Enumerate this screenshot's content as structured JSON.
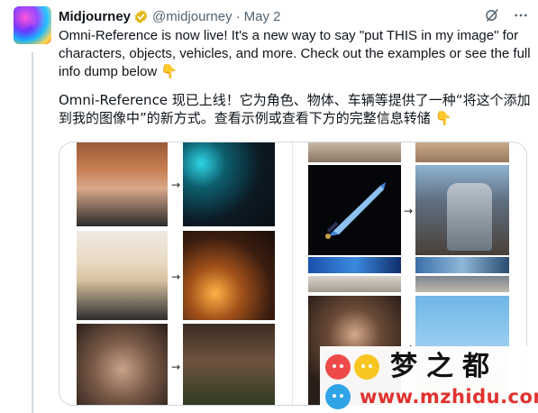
{
  "tweet": {
    "author_name": "Midjourney",
    "handle": "@midjourney",
    "separator": "·",
    "date": "May 2",
    "text_en": "Omni-Reference is now live! It's a new way to say \"put THIS in my image\" for characters, objects, vehicles, and more. Check out the examples or see the full info dump below",
    "text_en_emoji": "👇",
    "text_zh": "Omni-Reference 现已上线！它为角色、物体、车辆等提供了一种“将这个添加到我的图像中”的新方式。查看示例或查看下方的完整信息转储",
    "text_zh_emoji": "👇"
  },
  "header_icons": [
    "grok-icon",
    "more-icon"
  ],
  "media": {
    "arrows": [
      "→",
      "→",
      "→",
      "→",
      "→",
      "→"
    ]
  },
  "watermark": {
    "title": "梦之都",
    "url": "www.mzhidu.com"
  },
  "colors": {
    "text_primary": "#0f1419",
    "text_secondary": "#536471",
    "verified": "#e2b719",
    "border": "#cfd9de",
    "watermark_red": "#e0322f"
  }
}
